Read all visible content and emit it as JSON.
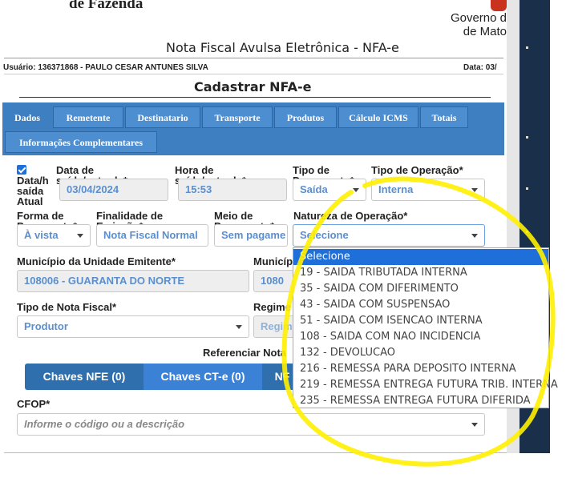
{
  "header": {
    "org_name": "de Fazenda",
    "gov_line1": "Governo d",
    "gov_line2": "de Mato",
    "title": "Nota Fiscal Avulsa Eletrônica - NFA-e",
    "user_label": "Usuário: 136371868 - PAULO CESAR ANTUNES SILVA",
    "date_label": "Data: 03/"
  },
  "page_subtitle": "Cadastrar NFA-e",
  "tabs": [
    {
      "label": "Dados",
      "active": true
    },
    {
      "label": "Remetente"
    },
    {
      "label": "Destinatario"
    },
    {
      "label": "Transporte"
    },
    {
      "label": "Produtos"
    },
    {
      "label": "Cálculo ICMS"
    },
    {
      "label": "Totais"
    },
    {
      "label": "Informações Complementares"
    }
  ],
  "form": {
    "checkbox_label": "Data/h saída Atual",
    "data_saida_label": "Data de saída/entrada*",
    "data_saida_value": "03/04/2024",
    "hora_saida_label": "Hora de saída/entrada*",
    "hora_saida_value": "15:53",
    "tipo_documento_label": "Tipo de Documento*",
    "tipo_documento_value": "Saída",
    "tipo_operacao_label": "Tipo de Operação*",
    "tipo_operacao_value": "Interna",
    "forma_pagamento_label": "Forma de Pagamento*",
    "forma_pagamento_value": "À vista",
    "finalidade_label": "Finalidade de Emissão*",
    "finalidade_value": "Nota Fiscal Normal",
    "meio_pagamento_label": "Meio de Pagamento*",
    "meio_pagamento_value": "Sem pagame",
    "natureza_label": "Natureza de Operação*",
    "natureza_value": "Selecione",
    "municipio_emitente_label": "Município da Unidade Emitente*",
    "municipio_emitente_value": "108006 - GUARANTA DO NORTE",
    "municipio2_label": "Municíp",
    "municipio2_value": "1080",
    "tipo_nota_label": "Tipo de Nota Fiscal*",
    "tipo_nota_value": "Produtor",
    "regime_label": "Regime",
    "regime_value": "Regim",
    "referenciar_label": "Referenciar Nota",
    "cfop_label": "CFOP*",
    "cfop_placeholder": "Informe o código ou a descrição"
  },
  "buttons": {
    "chaves_nfe": "Chaves NFE (0)",
    "chaves_cte": "Chaves CT-e (0)",
    "nf": "NF"
  },
  "natureza_options": [
    "Selecione",
    "19 - SAIDA TRIBUTADA INTERNA",
    "35 - SAIDA COM DIFERIMENTO",
    "43 - SAIDA COM SUSPENSAO",
    "51 - SAIDA COM ISENCAO INTERNA",
    "108 - SAIDA COM NAO INCIDENCIA",
    "132 - DEVOLUCAO",
    "216 - REMESSA PARA DEPOSITO INTERNA",
    "219 - REMESSA ENTREGA FUTURA TRIB. INTERNA",
    "235 - REMESSA ENTREGA FUTURA DIFERIDA"
  ],
  "colors": {
    "tab_bar": "#3d7fc1",
    "button_dark": "#2f6fad",
    "button_light": "#3b82d6",
    "option_selected": "#1e6fd9",
    "annotation": "#ffef00"
  }
}
